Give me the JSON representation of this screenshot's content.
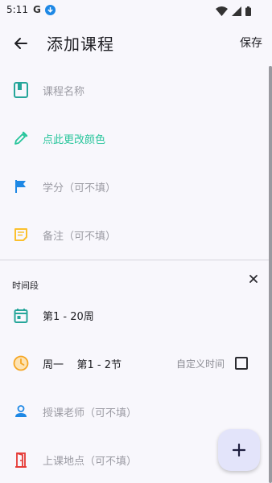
{
  "status_bar": {
    "time": "5:11",
    "g_label": "G",
    "icons": [
      "google-icon",
      "download-icon",
      "wifi-icon",
      "signal-icon",
      "battery-icon"
    ]
  },
  "appbar": {
    "title": "添加课程",
    "save_label": "保存",
    "back_icon": "arrow-left-icon"
  },
  "fields": {
    "course_name": {
      "placeholder": "课程名称",
      "icon": "book-icon",
      "icon_color": "#26a69a"
    },
    "color": {
      "label": "点此更改颜色",
      "icon": "eyedropper-icon",
      "icon_color": "#27c59b"
    },
    "credit": {
      "placeholder": "学分（可不填）",
      "icon": "flag-icon",
      "icon_color": "#1e88e5"
    },
    "note": {
      "placeholder": "备注（可不填）",
      "icon": "note-icon",
      "icon_color": "#fbc02d"
    }
  },
  "time_section": {
    "title": "时间段",
    "weeks": {
      "label": "第1 - 20周",
      "icon": "calendar-icon",
      "icon_color": "#26a69a"
    },
    "day_period": {
      "label": "周一    第1 - 2节",
      "icon": "clock-icon",
      "icon_color": "#f5a623"
    },
    "custom_time_label": "自定义时间",
    "custom_time_checked": false,
    "teacher": {
      "placeholder": "授课老师（可不填）",
      "icon": "person-icon",
      "icon_color": "#1e88e5"
    },
    "location": {
      "placeholder": "上课地点（可不填）",
      "icon": "door-icon",
      "icon_color": "#e53935"
    }
  },
  "fab": {
    "icon": "plus-icon"
  }
}
